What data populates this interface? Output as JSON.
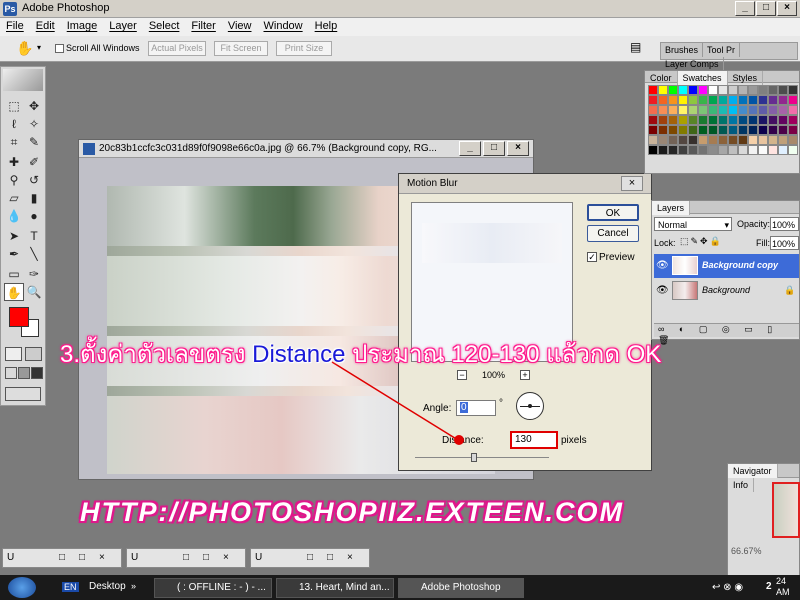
{
  "window": {
    "title": "Adobe Photoshop",
    "app_icon": "photoshop-icon"
  },
  "menu": [
    "File",
    "Edit",
    "Image",
    "Layer",
    "Select",
    "Filter",
    "View",
    "Window",
    "Help"
  ],
  "options_bar": {
    "scroll_all_label": "Scroll All Windows",
    "buttons": [
      "Actual Pixels",
      "Fit Screen",
      "Print Size"
    ],
    "palette_tabs": [
      "Brushes",
      "Tool Pr",
      "Layer Comps"
    ]
  },
  "document": {
    "title": "20c83b1ccfc3c031d89f0f9098e66c0a.jpg @ 66.7% (Background copy, RG...",
    "controls": [
      "_",
      "□",
      "×"
    ]
  },
  "dialog": {
    "title": "Motion Blur",
    "ok": "OK",
    "cancel": "Cancel",
    "preview_label": "Preview",
    "zoom": "100%",
    "zoom_out": "−",
    "zoom_in": "+",
    "angle_label": "Angle:",
    "angle_value": "0",
    "angle_unit": "°",
    "distance_label": "Distance:",
    "distance_value": "130",
    "distance_unit": "pixels"
  },
  "swatches_panel": {
    "tabs": [
      "Color",
      "Swatches",
      "Styles"
    ],
    "colors": [
      "#ff0000",
      "#ffff00",
      "#00ff00",
      "#00ffff",
      "#0000ff",
      "#ff00ff",
      "#ffffff",
      "#e6e6e6",
      "#cccccc",
      "#b3b3b3",
      "#999999",
      "#808080",
      "#666666",
      "#4d4d4d",
      "#333333",
      "#ed1c24",
      "#f26522",
      "#f7941d",
      "#fff200",
      "#8dc63f",
      "#39b54a",
      "#00a651",
      "#00a99d",
      "#00aeef",
      "#0072bc",
      "#0054a6",
      "#2e3192",
      "#662d91",
      "#92278f",
      "#ec008c",
      "#f26c4f",
      "#f68e56",
      "#fbaf5c",
      "#fff568",
      "#acd373",
      "#7cc576",
      "#3cb878",
      "#1cbbb4",
      "#00bff3",
      "#448ccb",
      "#5674b9",
      "#605ca8",
      "#855fa8",
      "#a763a8",
      "#f06eaa",
      "#9e0b0f",
      "#a0410d",
      "#a36209",
      "#aba000",
      "#598527",
      "#1a7b30",
      "#007236",
      "#00746b",
      "#0076a3",
      "#004a80",
      "#003471",
      "#1b1464",
      "#440e62",
      "#630460",
      "#9e005d",
      "#790000",
      "#7b2e00",
      "#7d4900",
      "#827b00",
      "#406618",
      "#005e20",
      "#005826",
      "#005952",
      "#005b7f",
      "#003663",
      "#002157",
      "#0d004c",
      "#32004b",
      "#4b0049",
      "#7b0046",
      "#c7b299",
      "#998675",
      "#736357",
      "#534741",
      "#37302d",
      "#c69c6d",
      "#a67c52",
      "#8c6239",
      "#754c24",
      "#603913",
      "#f5d0a9",
      "#e8c39e",
      "#d2b48c",
      "#bfa07a",
      "#a8896b",
      "#000000",
      "#1a1a1a",
      "#262626",
      "#404040",
      "#595959",
      "#737373",
      "#8c8c8c",
      "#a6a6a6",
      "#bfbfbf",
      "#d9d9d9",
      "#f2f2f2",
      "#fafafa",
      "#ffe4e1",
      "#e0f0ff",
      "#f0fff0"
    ]
  },
  "layers_panel": {
    "tab": "Layers",
    "blend_mode": "Normal",
    "opacity_label": "Opacity:",
    "opacity": "100%",
    "lock_label": "Lock:",
    "fill_label": "Fill:",
    "fill": "100%",
    "layers": [
      {
        "name": "Background copy",
        "selected": true
      },
      {
        "name": "Background",
        "selected": false
      }
    ]
  },
  "navigator_panel": {
    "tabs": [
      "Navigator",
      "Info"
    ],
    "zoom": "66.67%"
  },
  "minimized_windows": [
    {
      "label": "U",
      "controls": [
        "□",
        "□",
        "×"
      ]
    },
    {
      "label": "U",
      "controls": [
        "□",
        "□",
        "×"
      ]
    },
    {
      "label": "U",
      "controls": [
        "□",
        "□",
        "×"
      ]
    }
  ],
  "overlay": {
    "instruction_prefix": "3.ตั้งค่าตัวเลขตรง",
    "instruction_highlight": "Distance",
    "instruction_suffix": "ประมาณ 120-130 แล้วกด OK",
    "watermark": "HTTP://PHOTOSHOPIIZ.EXTEEN.COM"
  },
  "taskbar": {
    "lang": "EN",
    "desktop": "Desktop",
    "items": [
      "( : OFFLINE : - ) - ...",
      "13. Heart, Mind an...",
      "Adobe Photoshop"
    ],
    "clock_top": "24",
    "clock_bottom": "AM",
    "clock_left": "2"
  },
  "colors": {
    "accent": "#ff1a8c",
    "selection_blue": "#3d6bd8",
    "foreground": "#ff0000"
  }
}
